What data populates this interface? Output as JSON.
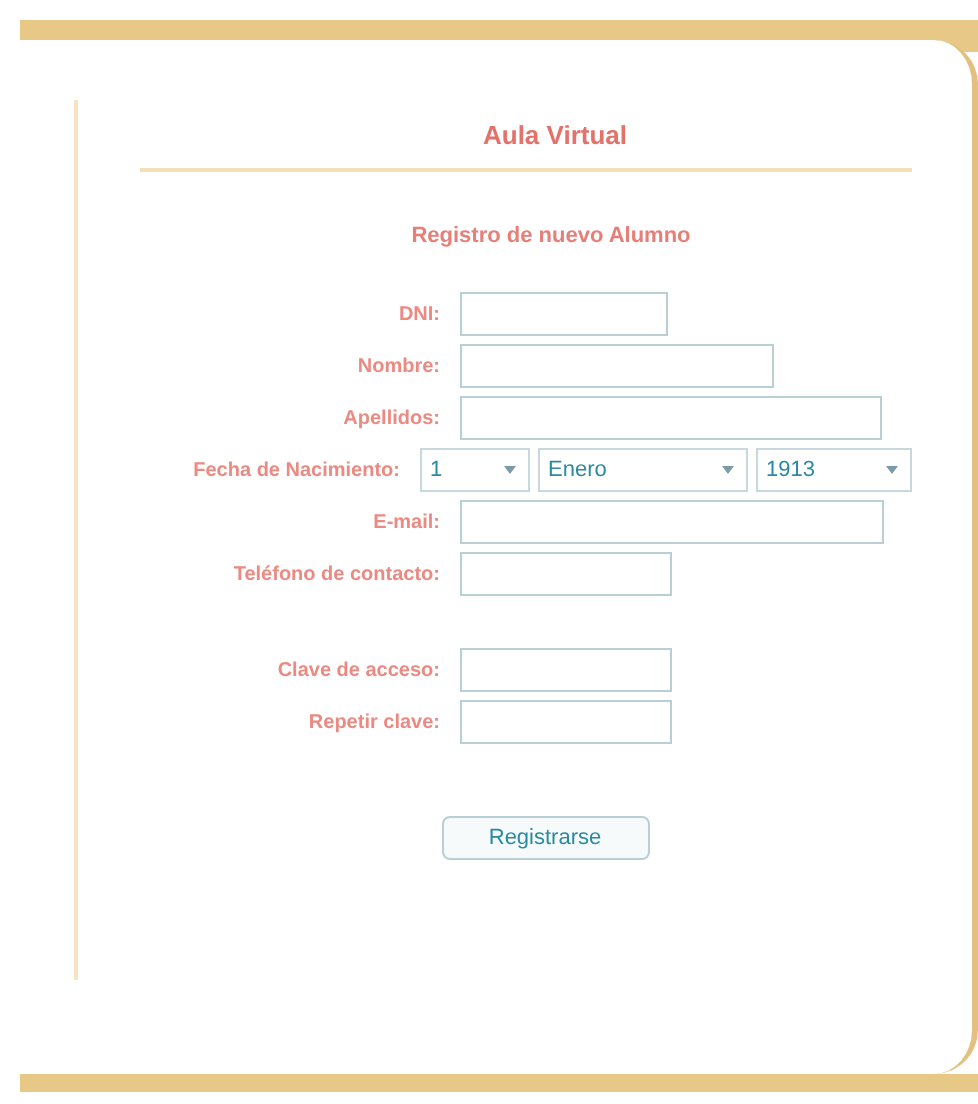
{
  "title": "Aula Virtual",
  "subtitle": "Registro de nuevo Alumno",
  "personal_fields": [
    {
      "kind": "text",
      "label": "DNI:"
    },
    {
      "kind": "text",
      "label": "Nombre:"
    },
    {
      "kind": "text",
      "label": "Apellidos:"
    },
    {
      "kind": "date",
      "label": "Fecha de Nacimiento:",
      "selects": [
        "1",
        "Enero",
        "1913"
      ]
    },
    {
      "kind": "text",
      "label": "E-mail:"
    },
    {
      "kind": "text",
      "label": "Teléfono de contacto:"
    }
  ],
  "access_fields": [
    {
      "kind": "text",
      "label": "Clave de acceso:"
    },
    {
      "kind": "text",
      "label": "Repetir clave:"
    }
  ],
  "submit_button": "Registrarse"
}
